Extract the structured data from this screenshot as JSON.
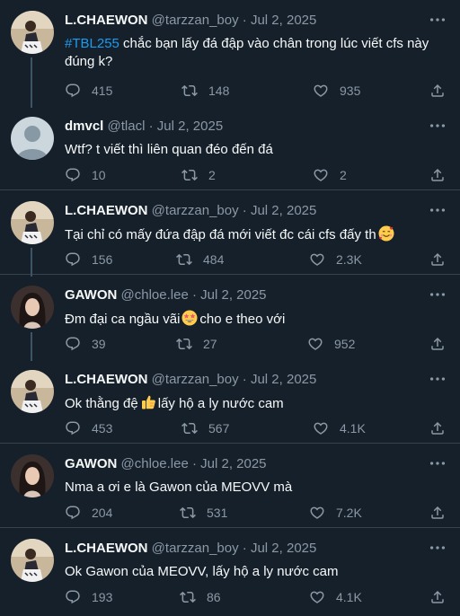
{
  "tweets": [
    {
      "name": "L.CHAEWON",
      "handle": "@tarzzan_boy",
      "date": "· Jul 2, 2025",
      "hashtag": "#TBL255",
      "text": " chắc bạn lấy đá đập vào chân trong lúc viết cfs này đúng k?",
      "replies": "415",
      "retweets": "148",
      "likes": "935"
    },
    {
      "name": "dmvcl",
      "handle": "@tlacl",
      "date": "· Jul 2, 2025",
      "text": "Wtf? t viết thì liên quan đéo đến đá",
      "replies": "10",
      "retweets": "2",
      "likes": "2"
    },
    {
      "name": "L.CHAEWON",
      "handle": "@tarzzan_boy",
      "date": "· Jul 2, 2025",
      "text": "Tại chỉ có mấy đứa đập đá mới viết đc cái cfs đấy th",
      "emoji": "smiling-face-with-hearts",
      "replies": "156",
      "retweets": "484",
      "likes": "2.3K"
    },
    {
      "name": "GAWON",
      "handle": "@chloe.lee",
      "date": "· Jul 2, 2025",
      "text_before": "Đm đại ca ngầu vãi",
      "emoji": "star-struck",
      "text_after": "cho e theo với",
      "replies": "39",
      "retweets": "27",
      "likes": "952"
    },
    {
      "name": "L.CHAEWON",
      "handle": "@tarzzan_boy",
      "date": "· Jul 2, 2025",
      "text_before": "Ok thằng đệ",
      "emoji": "thumbs-up",
      "text_after": "lấy hộ a ly nước cam",
      "replies": "453",
      "retweets": "567",
      "likes": "4.1K"
    },
    {
      "name": "GAWON",
      "handle": "@chloe.lee",
      "date": "· Jul 2, 2025",
      "text": "Nma a ơi e là Gawon của MEOVV mà",
      "replies": "204",
      "retweets": "531",
      "likes": "7.2K"
    },
    {
      "name": "L.CHAEWON",
      "handle": "@tarzzan_boy",
      "date": "· Jul 2, 2025",
      "text": "Ok Gawon của MEOVV, lấy hộ a ly nước cam",
      "replies": "193",
      "retweets": "86",
      "likes": "4.1K"
    }
  ],
  "colors": {
    "background": "#15202b",
    "text": "#f7f9f9",
    "secondary": "#8b98a5",
    "accent": "#1d9bf0",
    "divider": "#38444d"
  },
  "icons": [
    "more-icon",
    "reply-icon",
    "retweet-icon",
    "like-icon",
    "share-icon"
  ]
}
